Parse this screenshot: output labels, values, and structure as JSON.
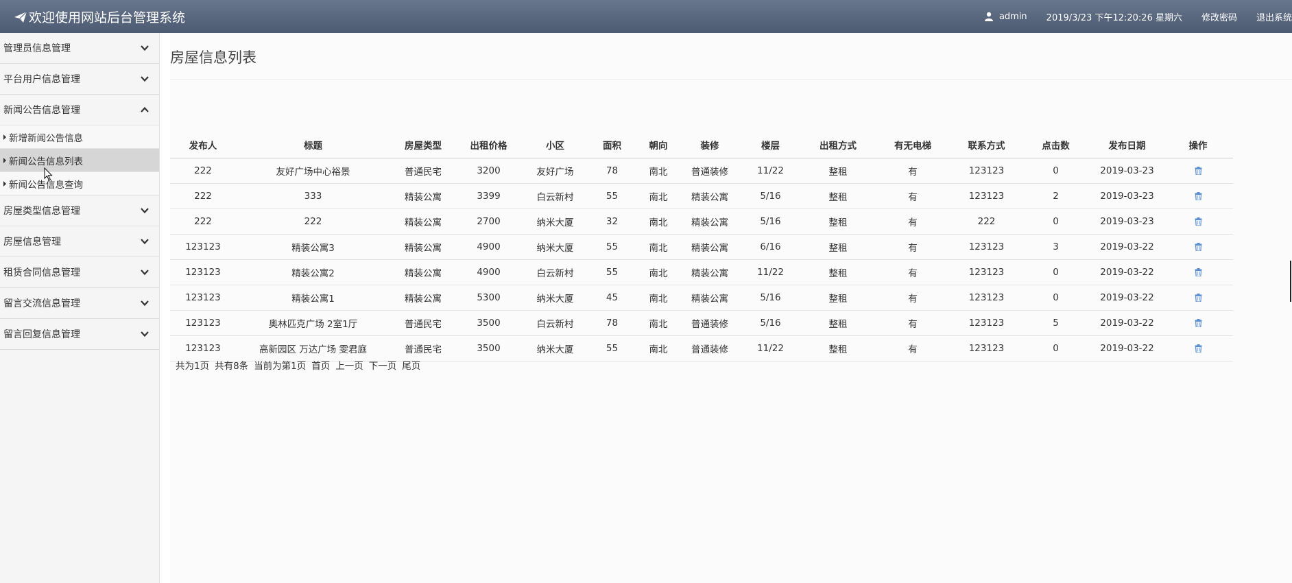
{
  "header": {
    "title": "欢迎使用网站后台管理系统",
    "username": "admin",
    "datetime": "2019/3/23 下午12:20:26 星期六",
    "change_password": "修改密码",
    "logout": "退出系统"
  },
  "sidebar": {
    "groups": [
      {
        "label": "管理员信息管理"
      },
      {
        "label": "平台用户信息管理"
      },
      {
        "label": "新闻公告信息管理",
        "expanded": true,
        "items": [
          {
            "label": "新增新闻公告信息"
          },
          {
            "label": "新闻公告信息列表",
            "active": true
          },
          {
            "label": "新闻公告信息查询"
          }
        ]
      },
      {
        "label": "房屋类型信息管理"
      },
      {
        "label": "房屋信息管理"
      },
      {
        "label": "租赁合同信息管理"
      },
      {
        "label": "留言交流信息管理"
      },
      {
        "label": "留言回复信息管理"
      }
    ]
  },
  "main": {
    "title": "房屋信息列表",
    "columns": [
      "发布人",
      "标题",
      "房屋类型",
      "出租价格",
      "小区",
      "面积",
      "朝向",
      "装修",
      "楼层",
      "出租方式",
      "有无电梯",
      "联系方式",
      "点击数",
      "发布日期",
      "操作"
    ],
    "rows": [
      [
        "222",
        "友好广场中心裕景",
        "普通民宅",
        "3200",
        "友好广场",
        "78",
        "南北",
        "普通装修",
        "11/22",
        "整租",
        "有",
        "123123",
        "0",
        "2019-03-23"
      ],
      [
        "222",
        "333",
        "精装公寓",
        "3399",
        "白云新村",
        "55",
        "南北",
        "精装公寓",
        "5/16",
        "整租",
        "有",
        "123123",
        "2",
        "2019-03-23"
      ],
      [
        "222",
        "222",
        "精装公寓",
        "2700",
        "纳米大厦",
        "32",
        "南北",
        "精装公寓",
        "5/16",
        "整租",
        "有",
        "222",
        "0",
        "2019-03-23"
      ],
      [
        "123123",
        "精装公寓3",
        "精装公寓",
        "4900",
        "纳米大厦",
        "55",
        "南北",
        "精装公寓",
        "6/16",
        "整租",
        "有",
        "123123",
        "3",
        "2019-03-22"
      ],
      [
        "123123",
        "精装公寓2",
        "精装公寓",
        "4900",
        "白云新村",
        "55",
        "南北",
        "精装公寓",
        "11/22",
        "整租",
        "有",
        "123123",
        "0",
        "2019-03-22"
      ],
      [
        "123123",
        "精装公寓1",
        "精装公寓",
        "5300",
        "纳米大厦",
        "45",
        "南北",
        "精装公寓",
        "5/16",
        "整租",
        "有",
        "123123",
        "0",
        "2019-03-22"
      ],
      [
        "123123",
        "奥林匹克广场 2室1厅",
        "普通民宅",
        "3500",
        "白云新村",
        "78",
        "南北",
        "普通装修",
        "5/16",
        "整租",
        "有",
        "123123",
        "5",
        "2019-03-22"
      ],
      [
        "123123",
        "高新园区 万达广场 雯君庭",
        "普通民宅",
        "3500",
        "纳米大厦",
        "55",
        "南北",
        "普通装修",
        "11/22",
        "整租",
        "有",
        "123123",
        "0",
        "2019-03-22"
      ]
    ],
    "action_icon": "trash-icon",
    "pagination": {
      "total_pages": "共为1页",
      "total_records": "共有8条",
      "current": "当前为第1页",
      "first": "首页",
      "prev": "上一页",
      "next": "下一页",
      "last": "尾页"
    }
  },
  "colors": {
    "header_top": "#67758d",
    "header_bottom": "#4c5a72",
    "active_item": "#d6d6d6",
    "icon_blue": "#5b8fd0"
  }
}
